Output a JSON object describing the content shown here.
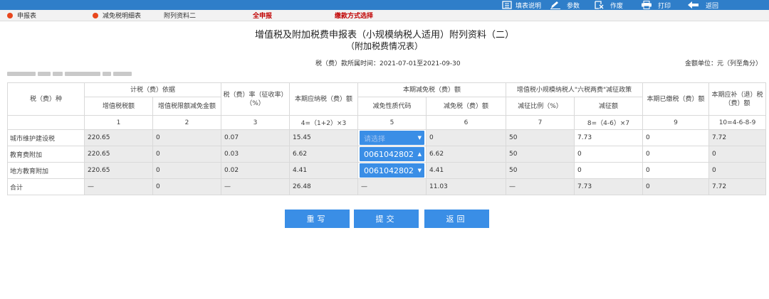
{
  "toolbar": {
    "items": [
      {
        "label": "填表说明",
        "icon": "list-icon"
      },
      {
        "label": "参数",
        "icon": "pencil-icon"
      },
      {
        "label": "作废",
        "icon": "void-document-icon"
      },
      {
        "label": "打印",
        "icon": "printer-icon"
      },
      {
        "label": "返回",
        "icon": "back-arrow-icon"
      }
    ]
  },
  "nav": {
    "items": [
      {
        "label": "申报表",
        "icon": "red-dot-icon"
      },
      {
        "label": "减免税明细表",
        "icon": "red-dot-icon"
      },
      {
        "label": "附列资料二"
      },
      {
        "label": "全申报"
      },
      {
        "label": "缴款方式选择"
      }
    ]
  },
  "header": {
    "title": "增值税及附加税费申报表（小规模纳税人适用）附列资料（二）",
    "subtitle": "（附加税费情况表）",
    "period": "税（费）款所属时间：2021-07-01至2021-09-30",
    "unit": "金额单位：元（列至角分）"
  },
  "table": {
    "headers": {
      "tax_type": "税（费）种",
      "basis_group": "计税（费）依据",
      "vat_amount": "增值税税额",
      "vat_credit": "增值税限额减免金额",
      "rate": "税（费）率（征收率）（%）",
      "payable": "本期应纳税（费）额",
      "relief_group": "本期减免税（费）额",
      "relief_code": "减免性质代码",
      "relief_amount": "减免税（费）额",
      "policy_group": "增值税小规模纳税人\"六税两费\"减征政策",
      "reduction_ratio": "减征比例（%）",
      "reduction_amount": "减征额",
      "paid": "本期已缴税（费）额",
      "refund": "本期应补（退）税（费）额"
    },
    "column_numbers": [
      "1",
      "2",
      "3",
      "4=（1+2）×3",
      "5",
      "6",
      "7",
      "8=（4-6）×7",
      "9",
      "10=4-6-8-9"
    ],
    "rows": [
      {
        "name": "城市维护建设税",
        "vat": "220.65",
        "credit": "0",
        "rate": "0.07",
        "payable": "15.45",
        "code": "请选择",
        "relief": "0",
        "ratio": "50",
        "reduction": "7.73",
        "paid": "0",
        "refund": "7.72"
      },
      {
        "name": "教育费附加",
        "vat": "220.65",
        "credit": "0",
        "rate": "0.03",
        "payable": "6.62",
        "code": "0061042802",
        "relief": "6.62",
        "ratio": "50",
        "reduction": "0",
        "paid": "0",
        "refund": "0"
      },
      {
        "name": "地方教育附加",
        "vat": "220.65",
        "credit": "0",
        "rate": "0.02",
        "payable": "4.41",
        "code": "0061042802",
        "relief": "4.41",
        "ratio": "50",
        "reduction": "0",
        "paid": "0",
        "refund": "0"
      }
    ],
    "total": {
      "name": "合计",
      "vat": "—",
      "credit": "0",
      "rate": "—",
      "payable": "26.48",
      "code": "—",
      "relief": "11.03",
      "ratio": "—",
      "reduction": "7.73",
      "paid": "0",
      "refund": "7.72"
    }
  },
  "buttons": {
    "rewrite": "重写",
    "submit": "提交",
    "back": "返回"
  },
  "colors": {
    "toolbar": "#2f7ec9",
    "button": "#3a8ee6",
    "highlight_red": "#c00000",
    "readonly_cell": "#ebebeb"
  }
}
